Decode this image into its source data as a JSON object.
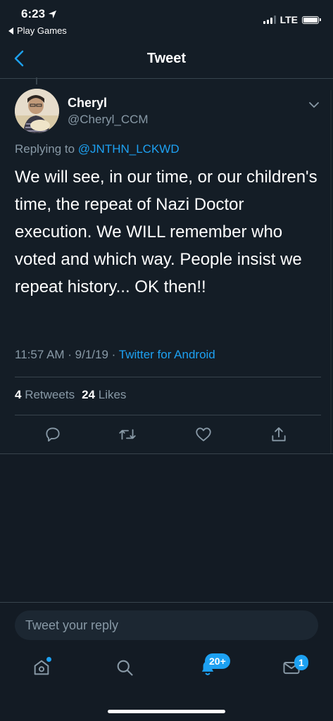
{
  "status_bar": {
    "time": "6:23",
    "back_app": "Play Games",
    "network": "LTE"
  },
  "nav": {
    "title": "Tweet",
    "back_icon": "chevron-left-icon"
  },
  "tweet": {
    "author_name": "Cheryl",
    "author_handle": "@Cheryl_CCM",
    "replying_prefix": "Replying to",
    "replying_to": "@JNTHN_LCKWD",
    "text": "We will see,  in our time, or our children's time,  the repeat of Nazi Doctor execution.  We WILL remember who voted and which way. People insist we repeat history... OK then!!",
    "timestamp": "11:57 AM · 9/1/19 · ",
    "source": "Twitter for Android",
    "retweets_count": "4",
    "retweets_label": "Retweets",
    "likes_count": "24",
    "likes_label": "Likes"
  },
  "reply": {
    "placeholder": "Tweet your reply"
  },
  "tabbar": {
    "notifications_badge": "20+",
    "messages_badge": "1"
  },
  "colors": {
    "background": "#141d26",
    "accent": "#1da1f2",
    "secondary_text": "#8899a6",
    "divider": "#38444d"
  }
}
